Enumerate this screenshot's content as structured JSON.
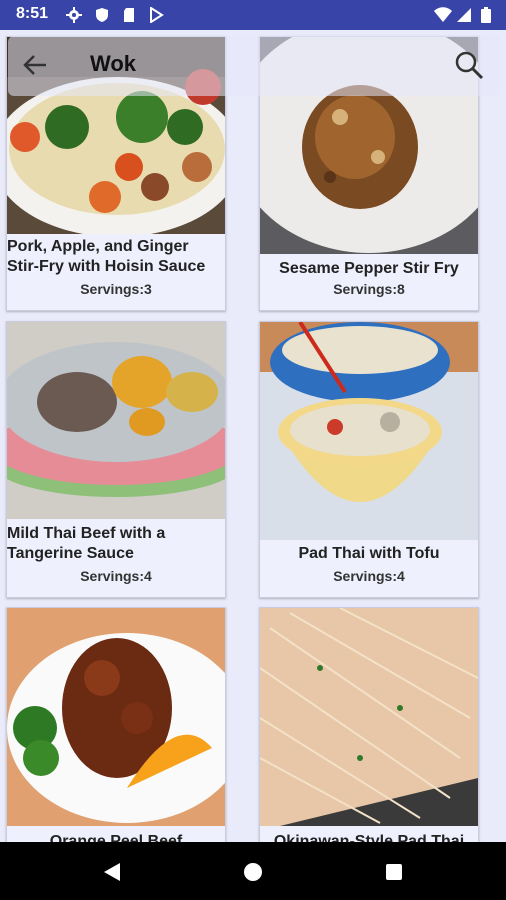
{
  "status_bar": {
    "time": "8:51",
    "left_icons": [
      "gear-icon",
      "shield-icon",
      "sd-card-icon",
      "play-store-icon"
    ],
    "right_icons": [
      "wifi-icon",
      "signal-icon",
      "battery-icon"
    ]
  },
  "toolbar": {
    "title": "Wok",
    "back_icon": "arrow-back-icon",
    "search_icon": "search-icon"
  },
  "recipes": [
    {
      "title_line1": "Pork, Apple, and Ginger",
      "title_line2": "Stir-Fry with Hoisin Sauce",
      "servings": "Servings:3"
    },
    {
      "title_line1": "Sesame Pepper Stir Fry",
      "title_line2": "",
      "servings": "Servings:8"
    },
    {
      "title_line1": "Mild Thai Beef with a",
      "title_line2": "Tangerine Sauce",
      "servings": "Servings:4"
    },
    {
      "title_line1": "Pad Thai with Tofu",
      "title_line2": "",
      "servings": "Servings:4"
    },
    {
      "title_line1": "Orange Peel Beef",
      "title_line2": "",
      "servings": ""
    },
    {
      "title_line1": "Okinawan-Style Pad Thai",
      "title_line2": "",
      "servings": ""
    }
  ],
  "nav_bar": {
    "buttons": [
      "back-triangle-icon",
      "home-circle-icon",
      "recents-square-icon"
    ]
  },
  "colors": {
    "status_bar": "#3844a8",
    "background": "#e9ebfa",
    "card": "#eef0fd",
    "nav_bar": "#000000"
  }
}
